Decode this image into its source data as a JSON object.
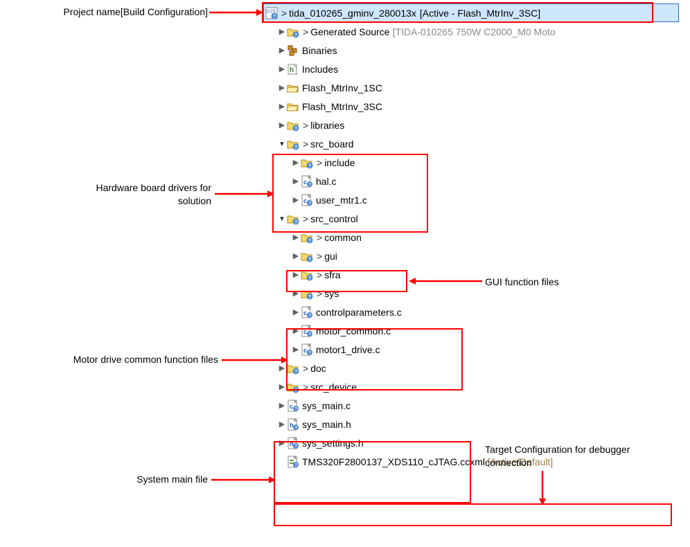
{
  "project": {
    "name": "tida_010265_gminv_280013x",
    "config": "[Active - Flash_MtrInv_3SC]"
  },
  "nodes": {
    "gensrc_label": "Generated Source",
    "gensrc_hint": "[TIDA-010265 750W C2000_M0 Moto",
    "binaries": "Binaries",
    "includes": "Includes",
    "flash1": "Flash_MtrInv_1SC",
    "flash3": "Flash_MtrInv_3SC",
    "libraries": "libraries",
    "src_board": "src_board",
    "include": "include",
    "hal_c": "hal.c",
    "user_mtr1_c": "user_mtr1.c",
    "src_control": "src_control",
    "common": "common",
    "gui": "gui",
    "sfra": "sfra",
    "sys": "sys",
    "controlparams_c": "controlparameters.c",
    "motor_common_c": "motor_common.c",
    "motor1_drive_c": "motor1_drive.c",
    "doc": "doc",
    "src_device": "src_device",
    "sys_main_c": "sys_main.c",
    "sys_main_h": "sys_main.h",
    "sys_settings_h": "sys_settings.h",
    "ccxml_name": "TMS320F2800137_XDS110_cJTAG.ccxml",
    "ccxml_status": "[Active/Default]"
  },
  "annotations": {
    "project": "Project name[Build Configuration]",
    "board_drivers_l1": "Hardware board drivers for",
    "board_drivers_l2": "solution",
    "motor_files": "Motor drive common function files",
    "sys_main": "System main file",
    "gui_files": "GUI function files",
    "target_cfg_l1": "Target Configuration for debugger",
    "target_cfg_l2": "connection"
  }
}
